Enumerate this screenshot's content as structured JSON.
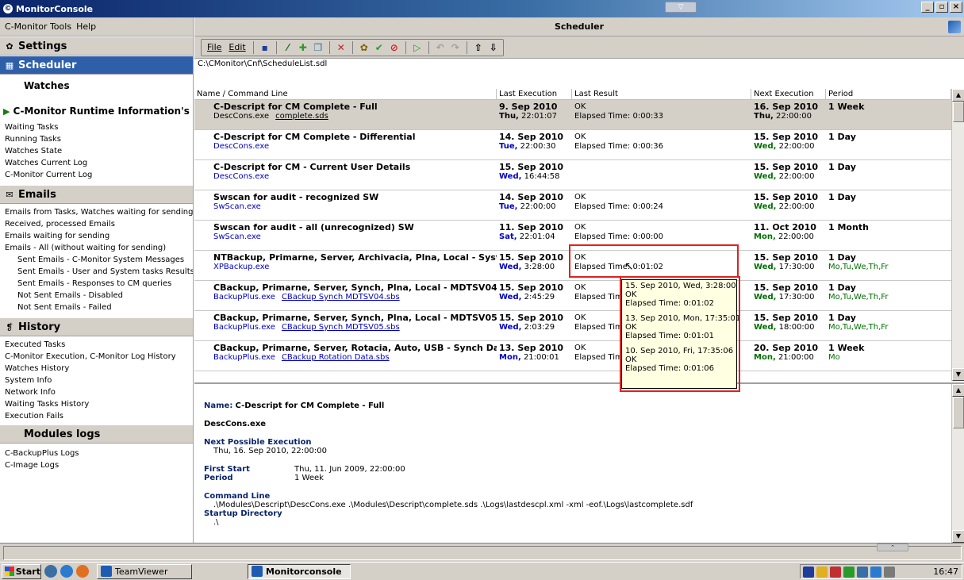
{
  "window": {
    "title": "MonitorConsole"
  },
  "left": {
    "menu": [
      "C-Monitor Tools",
      "Help"
    ],
    "settings_label": "Settings",
    "scheduler_label": "Scheduler",
    "watches_label": "Watches",
    "runtime_label": "C-Monitor Runtime Information's",
    "runtime_items": [
      "Waiting Tasks",
      "Running Tasks",
      "Watches State",
      "Watches Current Log",
      "C-Monitor Current Log"
    ],
    "emails_label": "Emails",
    "email_items": [
      {
        "label": "Emails from Tasks, Watches waiting for sending",
        "indent": false
      },
      {
        "label": "Received, processed Emails",
        "indent": false
      },
      {
        "label": "Emails waiting for sending",
        "indent": false
      },
      {
        "label": "Emails - All (without waiting for sending)",
        "indent": false
      },
      {
        "label": "Sent Emails - C-Monitor System Messages",
        "indent": true
      },
      {
        "label": "Sent Emails - User and System tasks Results",
        "indent": true
      },
      {
        "label": "Sent Emails - Responses to CM queries",
        "indent": true
      },
      {
        "label": "Not Sent Emails - Disabled",
        "indent": true
      },
      {
        "label": "Not Sent Emails - Failed",
        "indent": true
      }
    ],
    "history_label": "History",
    "history_items": [
      "Executed Tasks",
      "C-Monitor Execution, C-Monitor Log History",
      "Watches History",
      "System Info",
      "Network Info",
      "Waiting Tasks History",
      "Execution Fails"
    ],
    "modules_label": "Modules logs",
    "modules_items": [
      "C-BackupPlus Logs",
      "C-Image Logs"
    ]
  },
  "right": {
    "title": "Scheduler",
    "toolbar_menu": [
      "File",
      "Edit"
    ],
    "path": "C:\\CMonitor\\Cnf\\ScheduleList.sdl",
    "columns": [
      "Name / Command Line",
      "Last Execution",
      "Last Result",
      "Next Execution",
      "Period"
    ],
    "rows": [
      {
        "name": "C-Descript for CM Complete - Full",
        "cmd": "DescCons.exe",
        "link": "complete.sds",
        "last_date": "9. Sep 2010",
        "last_day": "Thu,",
        "last_time": "22:01:07",
        "result": "OK",
        "elapsed": "Elapsed Time: 0:00:33",
        "next_date": "16. Sep 2010",
        "next_day": "Thu,",
        "next_time": "22:00:00",
        "period": "1 Week",
        "days": "",
        "selected": true
      },
      {
        "name": "C-Descript for CM Complete - Differential",
        "cmd": "DescCons.exe",
        "link": "",
        "last_date": "14. Sep 2010",
        "last_day": "Tue,",
        "last_time": "22:00:30",
        "result": "OK",
        "elapsed": "Elapsed Time: 0:00:36",
        "next_date": "15. Sep 2010",
        "next_day": "Wed,",
        "next_time": "22:00:00",
        "period": "1 Day",
        "days": "",
        "selected": false
      },
      {
        "name": "C-Descript for CM - Current User Details",
        "cmd": "DescCons.exe",
        "link": "",
        "last_date": "15. Sep 2010",
        "last_day": "Wed,",
        "last_time": "16:44:58",
        "result": "",
        "elapsed": "",
        "next_date": "15. Sep 2010",
        "next_day": "Wed,",
        "next_time": "22:00:00",
        "period": "1 Day",
        "days": "",
        "selected": false
      },
      {
        "name": "Swscan for audit - recognized SW",
        "cmd": "SwScan.exe",
        "link": "",
        "last_date": "14. Sep 2010",
        "last_day": "Tue,",
        "last_time": "22:00:00",
        "result": "OK",
        "elapsed": "Elapsed Time: 0:00:24",
        "next_date": "15. Sep 2010",
        "next_day": "Wed,",
        "next_time": "22:00:00",
        "period": "1 Day",
        "days": "",
        "selected": false
      },
      {
        "name": "Swscan for audit - all (unrecognized) SW",
        "cmd": "SwScan.exe",
        "link": "",
        "last_date": "11. Sep 2010",
        "last_day": "Sat,",
        "last_time": "22:01:04",
        "result": "OK",
        "elapsed": "Elapsed Time: 0:00:00",
        "next_date": "11. Oct 2010",
        "next_day": "Mon,",
        "next_time": "22:00:00",
        "period": "1 Month",
        "days": "",
        "selected": false
      },
      {
        "name": "NTBackup, Primarne, Server, Archivacia, Plna, Local - System Sta",
        "cmd": "XPBackup.exe",
        "link": "",
        "last_date": "15. Sep 2010",
        "last_day": "Wed,",
        "last_time": "3:28:00",
        "result": "OK",
        "elapsed": "Elapsed Time: 0:01:02",
        "next_date": "15. Sep 2010",
        "next_day": "Wed,",
        "next_time": "17:30:00",
        "period": "1 Day",
        "days": "Mo,Tu,We,Th,Fr",
        "selected": false
      },
      {
        "name": "CBackup, Primarne, Server, Synch, Plna, Local - MDTSV04",
        "cmd": "BackupPlus.exe",
        "link": "CBackup Synch MDTSV04.sbs",
        "last_date": "15. Sep 2010",
        "last_day": "Wed,",
        "last_time": "2:45:29",
        "result": "OK",
        "elapsed": "Elapsed Time",
        "next_date": "15. Sep 2010",
        "next_day": "Wed,",
        "next_time": "17:30:00",
        "period": "1 Day",
        "days": "Mo,Tu,We,Th,Fr",
        "selected": false
      },
      {
        "name": "CBackup, Primarne, Server, Synch, Plna, Local - MDTSV05",
        "cmd": "BackupPlus.exe",
        "link": "CBackup Synch MDTSV05.sbs",
        "last_date": "15. Sep 2010",
        "last_day": "Wed,",
        "last_time": "2:03:29",
        "result": "OK",
        "elapsed": "Elapsed Time",
        "next_date": "15. Sep 2010",
        "next_day": "Wed,",
        "next_time": "18:00:00",
        "period": "1 Day",
        "days": "Mo,Tu,We,Th,Fr",
        "selected": false
      },
      {
        "name": "CBackup, Primarne, Server, Rotacia, Auto, USB - Synch Data, NT",
        "cmd": "BackupPlus.exe",
        "link": "CBackup Rotation Data.sbs",
        "last_date": "13. Sep 2010",
        "last_day": "Mon,",
        "last_time": "21:00:01",
        "result": "OK",
        "elapsed": "Elapsed Time",
        "next_date": "20. Sep 2010",
        "next_day": "Mon,",
        "next_time": "21:00:00",
        "period": "1 Week",
        "days": "Mo",
        "selected": false
      }
    ],
    "tooltip": [
      "15. Sep 2010, Wed, 3:28:00",
      "OK",
      "Elapsed Time: 0:01:02",
      "",
      "13. Sep 2010, Mon, 17:35:01",
      "OK",
      "Elapsed Time: 0:01:01",
      "",
      "10. Sep 2010, Fri, 17:35:06",
      "OK",
      "Elapsed Time: 0:01:06"
    ],
    "detail": {
      "name_label": "Name:",
      "name_value": "C-Descript for CM Complete - Full",
      "exe": "DescCons.exe",
      "next_label": "Next Possible Execution",
      "next_value": "Thu, 16. Sep 2010, 22:00:00",
      "first_start_label": "First Start",
      "first_start_value": "Thu, 11. Jun 2009, 22:00:00",
      "period_label": "Period",
      "period_value": "1 Week",
      "cmdline_label": "Command Line",
      "cmdline_value": ".\\Modules\\Descript\\DescCons.exe .\\Modules\\Descript\\complete.sds .\\Logs\\lastdescpl.xml -xml -eof.\\Logs\\lastcomplete.sdf",
      "startup_label": "Startup Directory",
      "startup_value": ".\\"
    }
  },
  "taskbar": {
    "start": "Start",
    "tasks": [
      "TeamViewer",
      "Monitorconsole"
    ],
    "clock": "16:47"
  }
}
